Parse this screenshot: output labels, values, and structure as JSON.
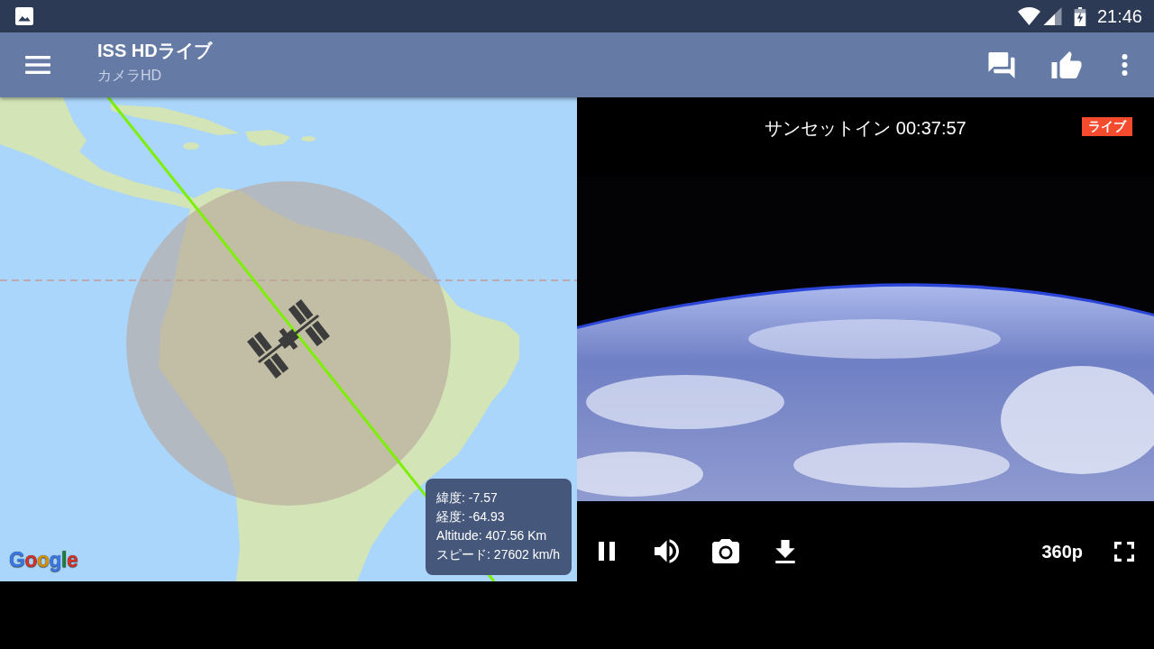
{
  "status_bar": {
    "time": "21:46"
  },
  "app_bar": {
    "title": "ISS HDライブ",
    "subtitle": "カメラHD"
  },
  "map": {
    "telemetry": [
      "緯度: -7.57",
      "経度: -64.93",
      "Altitude: 407.56 Km",
      "スピード: 27602 km/h"
    ],
    "logo": "Google"
  },
  "video": {
    "sunset_countdown": "サンセットイン 00:37:57",
    "live_badge": "ライブ",
    "playing": true,
    "quality": "360p"
  }
}
